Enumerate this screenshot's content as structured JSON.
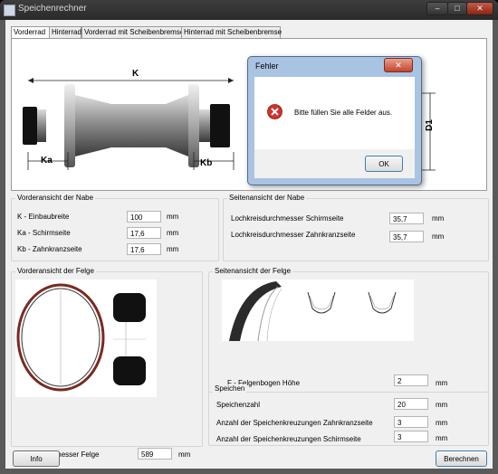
{
  "window": {
    "title": "Speichenrechner",
    "minimize": "–",
    "maximize": "□",
    "close": "✕"
  },
  "tabs": [
    "Vorderrad",
    "Hinterrad",
    "Vorderrad mit Scheibenbremse",
    "Hinterrad mit Scheibenbremse"
  ],
  "diagram": {
    "label_k": "K",
    "label_ka": "Ka",
    "label_kb": "Kb",
    "label_d1": "D1"
  },
  "dialog": {
    "title": "Fehler",
    "message": "Bitte füllen Sie alle Felder aus.",
    "ok": "OK",
    "close": "✕"
  },
  "hub_front": {
    "title": "Vorderansicht der Nabe",
    "rows": [
      {
        "label": "K - Einbaubreite",
        "value": "100",
        "unit": "mm"
      },
      {
        "label": "Ka - Schirmseite",
        "value": "17,6",
        "unit": "mm"
      },
      {
        "label": "Kb - Zahnkranzseite",
        "value": "17,6",
        "unit": "mm"
      }
    ]
  },
  "hub_side": {
    "title": "Seitenansicht der Nabe",
    "rows": [
      {
        "label": "Lochkreisdurchmesser Schirmseite",
        "value": "35,7",
        "unit": "mm"
      },
      {
        "label": "Lochkreisdurchmesser Zahnkranzseite",
        "value": "35,7",
        "unit": "mm"
      }
    ]
  },
  "rim_front": {
    "title": "Vorderansicht der Felge",
    "label": "Innendurchmesser Felge",
    "value": "589",
    "unit": "mm"
  },
  "rim_side": {
    "title": "Seitenansicht der Felge",
    "label": "F - Felgenbogen Höhe",
    "value": "2",
    "unit": "mm"
  },
  "spokes": {
    "title": "Speichen",
    "rows": [
      {
        "label": "Speichenzahl",
        "value": "20",
        "unit": "mm"
      },
      {
        "label": "Anzahl der Speichenkreuzungen Zahnkranzseite",
        "value": "3",
        "unit": "mm"
      },
      {
        "label": "Anzahl der Speichenkreuzungen Schirmseite",
        "value": "3",
        "unit": "mm"
      }
    ]
  },
  "buttons": {
    "info": "Info",
    "calculate": "Berechnen"
  }
}
